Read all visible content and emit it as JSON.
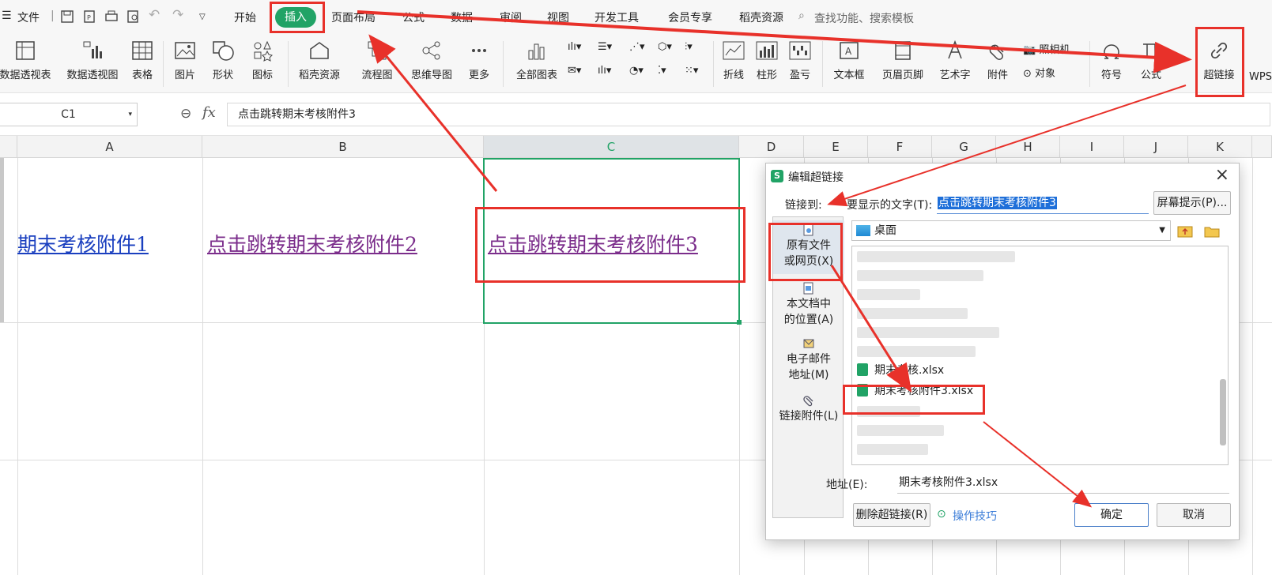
{
  "menu": {
    "file": "文件",
    "tabs": [
      "开始",
      "插入",
      "页面布局",
      "公式",
      "数据",
      "审阅",
      "视图",
      "开发工具",
      "会员专享",
      "稻壳资源"
    ],
    "active_tab": "插入",
    "search_placeholder": "查找功能、搜索模板"
  },
  "ribbon": {
    "pivot_table": "数据透视表",
    "pivot_chart": "数据透视图",
    "table": "表格",
    "picture": "图片",
    "shape": "形状",
    "icon": "图标",
    "daoke": "稻壳资源",
    "flowchart": "流程图",
    "mindmap": "思维导图",
    "more": "更多",
    "all_charts": "全部图表",
    "line": "折线",
    "column": "柱形",
    "winloss": "盈亏",
    "textbox": "文本框",
    "header_footer": "页眉页脚",
    "wordart": "艺术字",
    "attachment": "附件",
    "camera": "照相机",
    "object": "对象",
    "symbol": "符号",
    "formula": "公式",
    "hyperlink": "超链接",
    "wps": "WPS"
  },
  "formula_bar": {
    "name_box": "C1",
    "fx": "fx",
    "content": "点击跳转期末考核附件3"
  },
  "grid": {
    "columns": [
      "A",
      "B",
      "C",
      "D",
      "E",
      "F",
      "G",
      "H",
      "I",
      "J",
      "K"
    ],
    "cells": {
      "a1": "期末考核附件1",
      "b1": "点击跳转期末考核附件2",
      "c1": "点击跳转期末考核附件3"
    }
  },
  "dialog": {
    "title": "编辑超链接",
    "link_to": "链接到:",
    "display_text_label": "要显示的文字(T):",
    "display_text_value": "点击跳转期末考核附件3",
    "screen_tip": "屏幕提示(P)...",
    "sidebar": [
      {
        "label": "原有文件\n或网页(X)"
      },
      {
        "label": "本文档中\n的位置(A)"
      },
      {
        "label": "电子邮件\n地址(M)"
      },
      {
        "label": "链接附件(L)"
      }
    ],
    "folder": "桌面",
    "files": [
      "期末考核.xlsx",
      "期末考核附件3.xlsx"
    ],
    "address_label": "地址(E):",
    "address_value": "期末考核附件3.xlsx",
    "remove_link": "删除超链接(R)",
    "tips": "操作技巧",
    "ok": "确定",
    "cancel": "取消"
  },
  "colors": {
    "accent": "#21a366",
    "annotation": "#e8312a",
    "link_visited": "#7b2d8b",
    "link": "#1a3fbf"
  }
}
